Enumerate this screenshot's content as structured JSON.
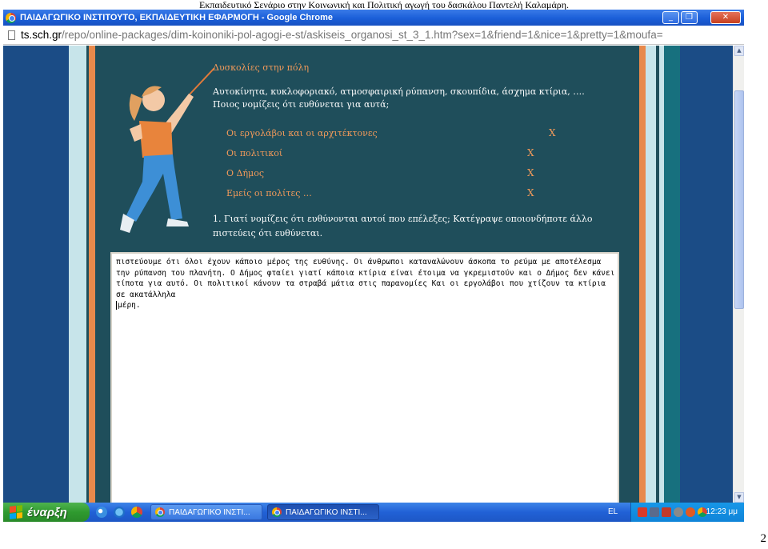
{
  "document": {
    "header": "Εκπαιδευτικό Σενάριο στην Κοινωνική και Πολιτική αγωγή του δασκάλου Παντελή Καλαμάρη.",
    "page_number": "2"
  },
  "browser": {
    "window_title": "ΠΑΙΔΑΓΩΓΙΚΟ ΙΝΣΤΙΤΟΥΤΟ, ΕΚΠΑΙΔΕΥΤΙΚΗ ΕΦΑΡΜΟΓΗ - Google Chrome",
    "url_host": "ts.sch.gr",
    "url_path": "/repo/online-packages/dim-koinoniki-pol-agogi-e-st/askiseis_organosi_st_3_1.htm?sex=1&friend=1&nice=1&pretty=1&moufa=",
    "controls": {
      "minimize": "_",
      "maximize": "❐",
      "close": "✕"
    }
  },
  "page": {
    "heading": "Δυσκολίες στην πόλη",
    "intro_line1": "Αυτοκίνητα, κυκλοφοριακό, ατμοσφαιρική ρύπανση, σκουπίδια, άσχημα κτίρια, ….",
    "intro_line2": "Ποιος νομίζεις ότι ευθύνεται για αυτά;",
    "options": [
      {
        "label": "Οι εργολάβοι και οι αρχιτέκτονες",
        "mark": "X"
      },
      {
        "label": "Οι πολιτικοί",
        "mark": "X"
      },
      {
        "label": "Ο Δήμος",
        "mark": "X"
      },
      {
        "label": "Εμείς οι πολίτες …",
        "mark": "X"
      }
    ],
    "question": "1. Γιατί νομίζεις ότι ευθύνονται αυτοί που επέλεξες; Κατέγραψε οποιονδήποτε άλλο πιστεύεις ότι ευθύνεται.",
    "answer": "πιστεύουμε ότι όλοι έχουν κάποιο μέρος της ευθύνης. Οι άνθρωποι καταναλώνουν άσκοπα το ρεύμα με αποτέλεσμα την ρύπανση του πλανήτη. Ο Δήμος φταίει γιατί κάποια κτίρια είναι έτοιμα να γκρεμιστούν και ο Δήμος δεν κάνει τίποτα για αυτό. Οι πολιτικοί κάνουν τα στραβά μάτια στις παρανομίες Και οι εργολάβοι που χτίζουν τα κτίρια σε ακατάλληλα",
    "answer_end": "μέρη."
  },
  "taskbar": {
    "start_label": "έναρξη",
    "tasks": [
      {
        "label": "ΠΑΙΔΑΓΩΓΙΚΟ ΙΝΣΤΙ..."
      },
      {
        "label": "ΠΑΙΔΑΓΩΓΙΚΟ ΙΝΣΤΙ..."
      }
    ],
    "language": "EL",
    "clock": "12:23 μμ"
  },
  "colors": {
    "accent_orange": "#f29a5a",
    "panel_teal": "#1f4e5b",
    "background_blue": "#1b4c86"
  }
}
